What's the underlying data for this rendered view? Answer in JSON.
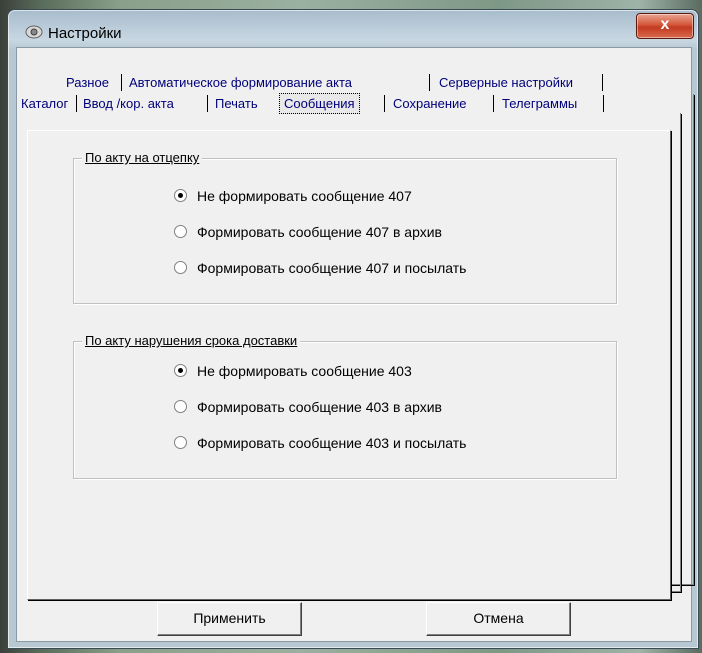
{
  "window": {
    "title": "Настройки",
    "close_glyph": "x"
  },
  "tabs": {
    "row1": [
      "Разное",
      "Автоматическое формирование акта",
      "Серверные настройки"
    ],
    "row2": [
      "Каталог",
      "Ввод /кор. акта",
      "Печать",
      "Сообщения",
      "Сохранение",
      "Телеграммы"
    ],
    "active": "Сообщения"
  },
  "group1": {
    "title": "По акту на отцепку",
    "options": [
      {
        "label": "Не формировать сообщение 407",
        "checked": true
      },
      {
        "label": "Формировать сообщение 407 в архив",
        "checked": false
      },
      {
        "label": "Формировать сообщение 407  и  посылать",
        "checked": false
      }
    ]
  },
  "group2": {
    "title": "По акту нарушения срока доставки",
    "options": [
      {
        "label": "Не формировать сообщение 403",
        "checked": true
      },
      {
        "label": "Формировать сообщение 403 в архив",
        "checked": false
      },
      {
        "label": "Формировать сообщение 403  и  посылать",
        "checked": false
      }
    ]
  },
  "buttons": {
    "apply": "Применить",
    "cancel": "Отмена"
  },
  "icons": {
    "app": "settings-app-icon",
    "close": "close-icon"
  }
}
